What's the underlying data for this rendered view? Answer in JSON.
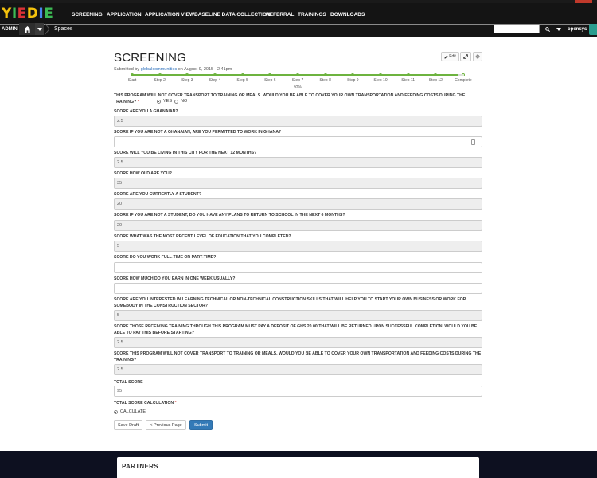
{
  "nav": {
    "logo": "YIEDIE",
    "links": [
      "SCREENING",
      "APPLICATION",
      "APPLICATION VIEW",
      "BASELINE DATA COLLECTION",
      "REFERRAL",
      "TRAININGS",
      "DOWNLOADS"
    ]
  },
  "subbar": {
    "admin": "ADMIN",
    "spaces": "Spaces",
    "user": "opensys",
    "search_placeholder": ""
  },
  "page": {
    "title": "SCREENING",
    "submitted_prefix": "Submitted by ",
    "submitted_user": "globalcommunities",
    "submitted_suffix": " on August 9, 2015 - 2:41pm",
    "edit_label": "Edit"
  },
  "progress": {
    "steps": [
      "Start",
      "Step 2",
      "Step 3",
      "Step 4",
      "Step 5",
      "Step 6",
      "Step 7",
      "Step 8",
      "Step 9",
      "Step 10",
      "Step 11",
      "Step 12",
      "Complete"
    ],
    "percent_label": "92%",
    "percent": 92
  },
  "form": {
    "q_transport_top": "THIS PROGRAM WILL NOT COVER TRANSPORT TO TRAINING OR MEALS. WOULD YOU BE ABLE TO COVER YOUR OWN TRANSPORTATION AND FEEDING COSTS DURING THE TRAINING?",
    "yes": "YES",
    "no": "NO",
    "fields": [
      {
        "label": "SCORE ARE YOU A GHANAIAN?",
        "value": "2.5",
        "readonly": true
      },
      {
        "label": "SCORE IF YOU ARE NOT A GHANAIAN, ARE YOU PERMITTED TO WORK IN GHANA?",
        "value": "",
        "readonly": false
      },
      {
        "label": "SCORE WILL YOU BE LIVING IN THIS CITY FOR THE NEXT 12 MONTHS?",
        "value": "2.5",
        "readonly": true
      },
      {
        "label": "SCORE HOW OLD ARE YOU?",
        "value": "35",
        "readonly": true
      },
      {
        "label": "SCORE ARE YOU CURRENTLY A STUDENT?",
        "value": "20",
        "readonly": true
      },
      {
        "label": "SCORE IF YOU ARE NOT A STUDENT, DO YOU HAVE ANY PLANS TO RETURN TO SCHOOL IN THE NEXT 6 MONTHS?",
        "value": "20",
        "readonly": true
      },
      {
        "label": "SCORE WHAT WAS THE MOST RECENT LEVEL OF EDUCATION THAT YOU COMPLETED?",
        "value": "5",
        "readonly": true
      },
      {
        "label": "SCORE DO YOU WORK FULL-TIME OR PART-TIME?",
        "value": "",
        "readonly": false
      },
      {
        "label": "SCORE HOW MUCH DO YOU EARN IN ONE WEEK USUALLY?",
        "value": "",
        "readonly": false
      },
      {
        "label": "SCORE ARE YOU INTERESTED IN LEARNING TECHNICAL OR NON-TECHNICAL CONSTRUCTION SKILLS THAT WILL HELP YOU TO START YOUR OWN BUSINESS OR WORK FOR SOMEBODY IN THE CONSTRUCTION SECTOR?",
        "value": "5",
        "readonly": true
      },
      {
        "label": "SCORE THOSE RECEIVING TRAINING THROUGH THIS PROGRAM MUST PAY A DEPOSIT OF GHS 20.00 THAT WILL BE RETURNED UPON SUCCESSFUL COMPLETION. WOULD YOU BE ABLE TO PAY THIS BEFORE STARTING?",
        "value": "2.5",
        "readonly": true
      },
      {
        "label": "SCORE THIS PROGRAM WILL NOT COVER TRANSPORT TO TRAINING OR MEALS. WOULD YOU BE ABLE TO COVER YOUR OWN TRANSPORTATION AND FEEDING COSTS DURING THE TRAINING?",
        "value": "2.5",
        "readonly": true
      },
      {
        "label": "TOTAL SCORE",
        "value": "95",
        "readonly": false
      }
    ],
    "total_calc_label": "TOTAL SCORE CALCULATION",
    "calculate": "CALCULATE",
    "save_draft": "Save Draft",
    "previous_page": "< Previous Page",
    "submit": "Submit"
  },
  "footer": {
    "partners": "PARTNERS"
  },
  "colors": {
    "accent": "#337ab7",
    "progress": "#6db33f",
    "navbar": "#141414"
  }
}
